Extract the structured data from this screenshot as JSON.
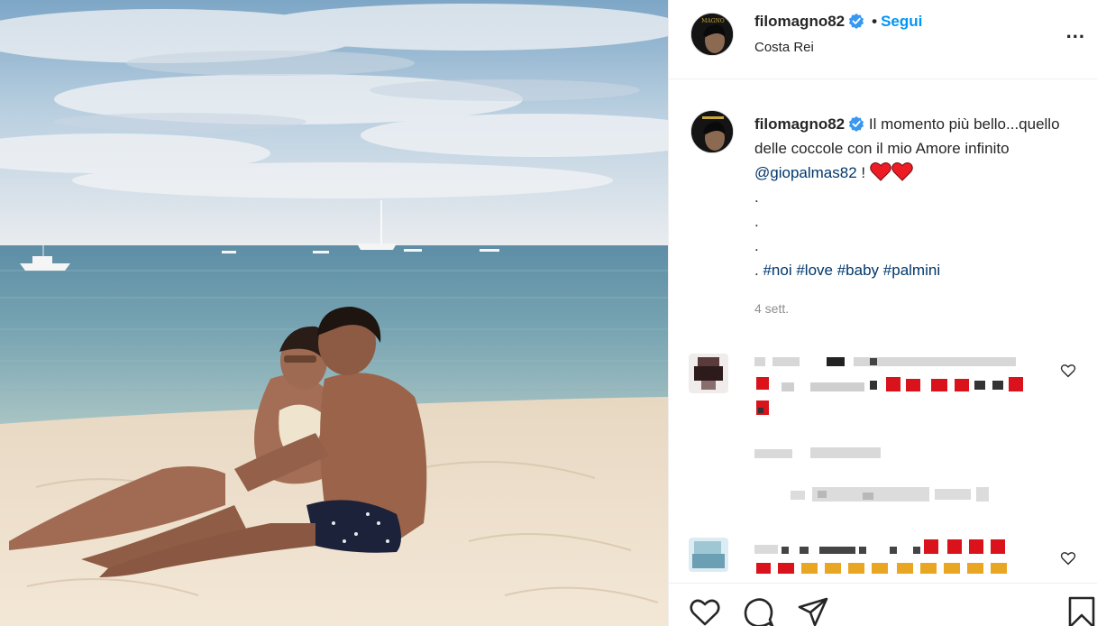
{
  "post": {
    "username": "filomagno82",
    "follow_label": "Segui",
    "separator": "•",
    "location": "Costa Rei",
    "more_label": "...",
    "avatar_text": "MAGNO"
  },
  "caption": {
    "username": "filomagno82",
    "text_1": "Il momento più bello...quello delle coccole con il mio Amore infinito",
    "mention": "@giopalmas82",
    "text_2": "!",
    "dot_1": ".",
    "dot_2": ".",
    "dot_3": ".",
    "dot_4": ".",
    "hashtags": [
      "#noi",
      "#love",
      "#baby",
      "#palmini"
    ],
    "timestamp": "4 sett."
  },
  "colors": {
    "link_blue": "#0095f6",
    "verified_blue": "#3897f0",
    "hashtag_blue": "#00376b",
    "muted_text": "#8e8e8e",
    "heart_red": "#ed1c24"
  },
  "icons": {
    "like": "heart-outline-icon",
    "comment": "speech-bubble-icon",
    "share": "paper-plane-icon",
    "save": "bookmark-icon",
    "more": "ellipsis-icon",
    "verified": "verified-badge-icon"
  }
}
